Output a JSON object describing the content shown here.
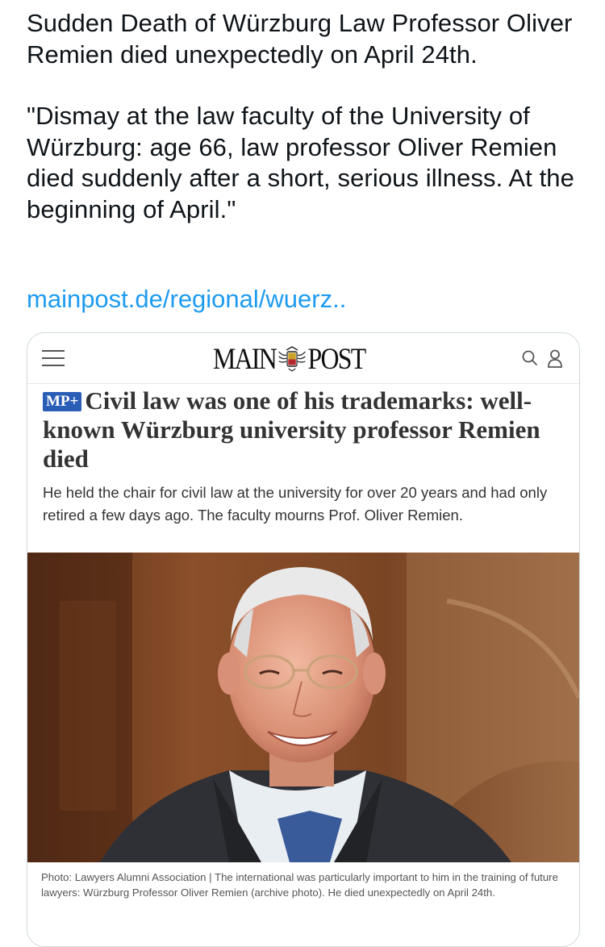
{
  "tweet": {
    "paragraph1": "Sudden Death of Würzburg Law Professor Oliver Remien died unexpectedly on April 24th.",
    "paragraph2": "\"Dismay at the law faculty of the University of Würzburg: age 66, law professor Oliver Remien died suddenly after a short, serious illness. At the beginning of April.\"",
    "link_text": "mainpost.de/regional/wuerz..",
    "link_color": "#1d9bf0"
  },
  "card": {
    "header": {
      "menu_icon": "hamburger-menu-icon",
      "logo_left": "MAIN",
      "logo_right": "POST",
      "search_icon": "search-icon",
      "account_icon": "user-icon"
    },
    "badge": "MP+",
    "badge_color": "#2a5db5",
    "headline": "Civil law was one of his trademarks: well-known Würzburg university professor Remien died",
    "teaser": "He held the chair for civil law at the university for over 20 years and had only retired a few days ago. The faculty mourns Prof. Oliver Remien.",
    "caption": "Photo: Lawyers Alumni Association | The international was particularly important to him in the training of future lawyers: Würzburg Professor Oliver Remien (archive photo). He died unexpectedly on April 24th."
  }
}
